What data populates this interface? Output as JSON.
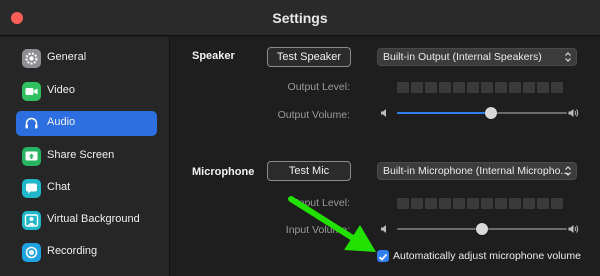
{
  "window": {
    "title": "Settings"
  },
  "sidebar": {
    "items": [
      {
        "label": "General",
        "icon": "gear-icon",
        "active": false,
        "color": "#8e8e93"
      },
      {
        "label": "Video",
        "icon": "video-camera-icon",
        "active": false,
        "color": "#30c060"
      },
      {
        "label": "Audio",
        "icon": "headphones-icon",
        "active": true,
        "color": "#2d6fe0"
      },
      {
        "label": "Share Screen",
        "icon": "share-screen-icon",
        "active": false,
        "color": "#28b462"
      },
      {
        "label": "Chat",
        "icon": "chat-bubble-icon",
        "active": false,
        "color": "#1fb7c9"
      },
      {
        "label": "Virtual Background",
        "icon": "person-background-icon",
        "active": false,
        "color": "#1fb7c9"
      },
      {
        "label": "Recording",
        "icon": "record-icon",
        "active": false,
        "color": "#1fa3e0"
      }
    ]
  },
  "speaker": {
    "section_label": "Speaker",
    "test_button": "Test Speaker",
    "device": "Built-in Output (Internal Speakers)",
    "output_level_label": "Output Level:",
    "output_volume_label": "Output Volume:",
    "output_volume": 0.55
  },
  "microphone": {
    "section_label": "Microphone",
    "test_button": "Test Mic",
    "device": "Built-in Microphone (Internal Micropho...",
    "input_level_label": "Input Level:",
    "input_volume_label": "Input Volume:",
    "input_volume": 0.5,
    "auto_adjust_label": "Automatically adjust microphone volume",
    "auto_adjust_checked": true
  },
  "colors": {
    "accent": "#2d6fe0",
    "annotation_arrow": "#22e000"
  }
}
